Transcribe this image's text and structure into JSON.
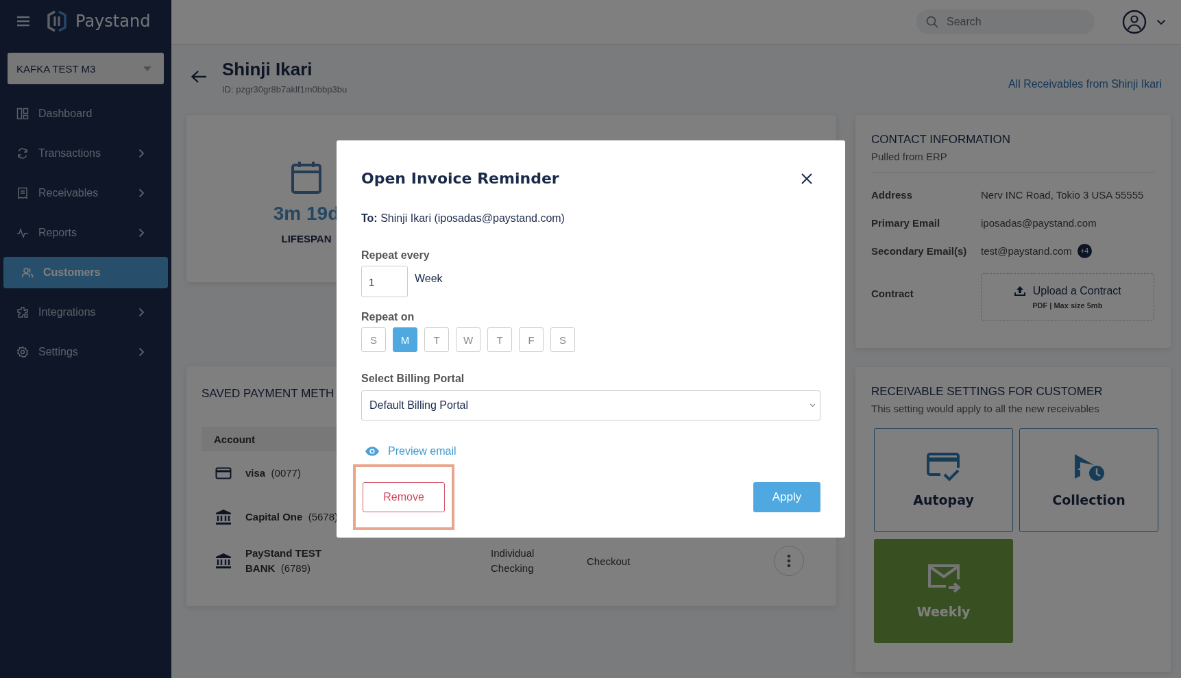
{
  "app": {
    "brand": "Paystand",
    "account": "KAFKA TEST M3"
  },
  "sidebar": {
    "items": [
      {
        "label": "Dashboard",
        "expandable": false,
        "selected": false
      },
      {
        "label": "Transactions",
        "expandable": true,
        "selected": false
      },
      {
        "label": "Receivables",
        "expandable": true,
        "selected": false
      },
      {
        "label": "Reports",
        "expandable": true,
        "selected": false
      },
      {
        "label": "Customers",
        "expandable": false,
        "selected": true
      },
      {
        "label": "Integrations",
        "expandable": true,
        "selected": false
      },
      {
        "label": "Settings",
        "expandable": true,
        "selected": false
      }
    ]
  },
  "topbar": {
    "search": {
      "placeholder": "Search"
    }
  },
  "customer": {
    "name": "Shinji Ikari",
    "id": "ID: pzgr30gr8b7aklf1m0bbp3bu",
    "link": "All Receivables from Shinji Ikari"
  },
  "lifespan": {
    "value": "3m 19d",
    "label": "LIFESPAN"
  },
  "payments": {
    "title": "SAVED PAYMENT METH",
    "columns": [
      "Account"
    ],
    "rows": [
      {
        "kind": "card",
        "name": "visa",
        "number": "(0077)"
      },
      {
        "kind": "bank",
        "name": "Capital One",
        "number": "(5678)"
      },
      {
        "kind": "bank",
        "name": "PayStand TEST BANK",
        "number": "(6789)",
        "column_3": "Individual Checking",
        "column_4": "Checkout",
        "actions": true
      }
    ]
  },
  "contact": {
    "title": "CONTACT INFORMATION",
    "subtitle": "Pulled from ERP",
    "fields": [
      {
        "kind": "text",
        "label": "Address",
        "value": "Nerv INC Road, Tokio 3 USA 55555"
      },
      {
        "kind": "text",
        "label": "Primary Email",
        "value": "iposadas@paystand.com"
      },
      {
        "kind": "text",
        "label": "Secondary Email(s)",
        "value": "test@paystand.com",
        "badge": "+4"
      },
      {
        "kind": "upload",
        "label": "Contract",
        "value": "Upload a Contract",
        "hint": "PDF | Max size 5mb"
      }
    ]
  },
  "settings": {
    "title": "RECEIVABLE SETTINGS FOR CUSTOMER",
    "subtitle": "This setting would apply to all the new receivables",
    "tiles": [
      {
        "label": "Autopay",
        "selected": false
      },
      {
        "label": "Collection",
        "selected": false
      },
      {
        "label": "Weekly",
        "selected": true
      }
    ]
  },
  "modal": {
    "title": "Open Invoice Reminder",
    "to": "**To:** Shinji Ikari (iposadas@paystand.com)",
    "repeat_label": "Repeat every",
    "repeat_value": "1",
    "repeat_unit": "Week",
    "days_label": "Repeat on",
    "days": [
      {
        "label": "S",
        "selected": false
      },
      {
        "label": "M",
        "selected": true
      },
      {
        "label": "T",
        "selected": false
      },
      {
        "label": "W",
        "selected": false
      },
      {
        "label": "T",
        "selected": false
      },
      {
        "label": "F",
        "selected": false
      },
      {
        "label": "S",
        "selected": false
      }
    ],
    "portal_label": "Select Billing Portal",
    "portal": "Default Billing Portal",
    "preview": "Preview email",
    "remove": "Remove",
    "remove_highlighted": true,
    "apply": "Apply"
  }
}
